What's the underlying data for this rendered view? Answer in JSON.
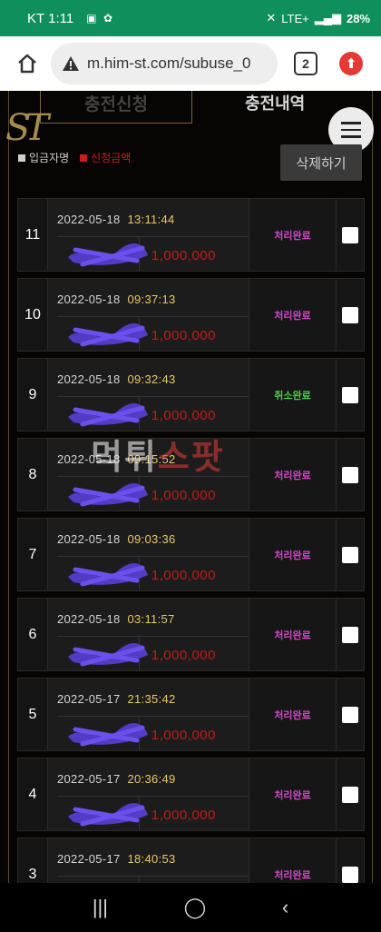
{
  "status_bar": {
    "carrier": "KT",
    "time": "1:11",
    "network": "LTE+",
    "battery": "28%"
  },
  "browser": {
    "url": "m.him-st.com/subuse_0",
    "tab_count": "2"
  },
  "page": {
    "tab_apply": "충전신청",
    "tab_history": "충전내역",
    "logo_text": "ST",
    "legend_name": "입금자명",
    "legend_amount": "신청금액",
    "delete_label": "삭제하기",
    "watermark_a": "먹튀",
    "watermark_b": "스팟",
    "accent_red": "#c01c1c",
    "accent_gold": "#e8c86a"
  },
  "rows": [
    {
      "num": "11",
      "date": "2022-05-18",
      "time": "13:11:44",
      "amount": "1,000,000",
      "status": "처리완료",
      "status_color": "#d348c8"
    },
    {
      "num": "10",
      "date": "2022-05-18",
      "time": "09:37:13",
      "amount": "1,000,000",
      "status": "처리완료",
      "status_color": "#d348c8"
    },
    {
      "num": "9",
      "date": "2022-05-18",
      "time": "09:32:43",
      "amount": "1,000,000",
      "status": "취소완료",
      "status_color": "#4fd14f"
    },
    {
      "num": "8",
      "date": "2022-05-18",
      "time": "09:15:52",
      "amount": "1,000,000",
      "status": "처리완료",
      "status_color": "#d348c8"
    },
    {
      "num": "7",
      "date": "2022-05-18",
      "time": "09:03:36",
      "amount": "1,000,000",
      "status": "처리완료",
      "status_color": "#d348c8"
    },
    {
      "num": "6",
      "date": "2022-05-18",
      "time": "03:11:57",
      "amount": "1,000,000",
      "status": "처리완료",
      "status_color": "#d348c8"
    },
    {
      "num": "5",
      "date": "2022-05-17",
      "time": "21:35:42",
      "amount": "1,000,000",
      "status": "처리완료",
      "status_color": "#d348c8"
    },
    {
      "num": "4",
      "date": "2022-05-17",
      "time": "20:36:49",
      "amount": "1,000,000",
      "status": "처리완료",
      "status_color": "#d348c8"
    },
    {
      "num": "3",
      "date": "2022-05-17",
      "time": "18:40:53",
      "amount": "",
      "status": "처리완료",
      "status_color": "#d348c8"
    }
  ]
}
